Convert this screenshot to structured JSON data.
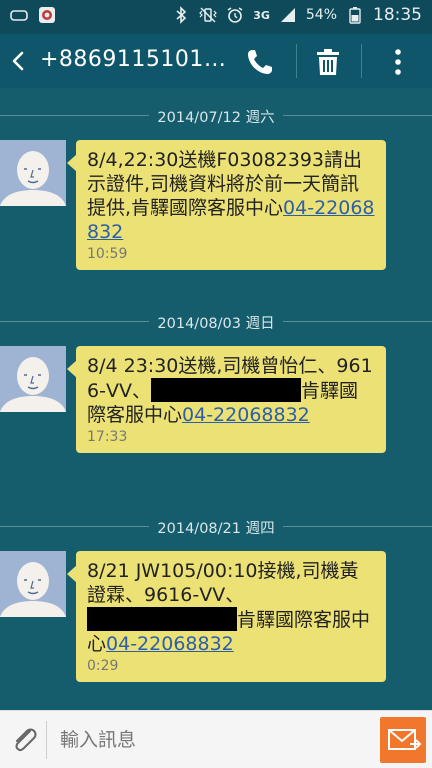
{
  "status_bar": {
    "time": "18:35",
    "battery": "54%",
    "network": "3G",
    "icons": [
      "notification-icon",
      "app-icon",
      "bluetooth-icon",
      "vibrate-icon",
      "alarm-icon",
      "signal-icon",
      "battery-icon"
    ]
  },
  "header": {
    "title": "+8869115101…",
    "icons": {
      "back": "back-arrow-icon",
      "call": "phone-icon",
      "delete": "trash-icon",
      "more": "more-vert-icon"
    }
  },
  "messages": [
    {
      "date": "2014/07/12 週六",
      "text_before": "8/4,22:30送機F03082393請出示證件,司機資料將於前一天簡訊提供,肯驛國際客服中心",
      "phone": "04-22068832",
      "time": "10:59"
    },
    {
      "date": "2014/08/03 週日",
      "text_before": "8/4 23:30送機,司機曾怡仁、9616-VV、",
      "text_after": "肯驛國際客服中心",
      "phone": "04-22068832",
      "time": "17:33"
    },
    {
      "date": "2014/08/21 週四",
      "text_before": "8/21 JW105/00:10接機,司機黃證霖、9616-VV、",
      "text_after": "肯驛國際客服中心",
      "phone": "04-22068832",
      "time": "0:29"
    }
  ],
  "input": {
    "placeholder": "輸入訊息",
    "icons": {
      "attach": "paperclip-icon",
      "send": "send-envelope-icon"
    }
  },
  "colors": {
    "background": "#155c6d",
    "appbar": "#10566a",
    "bubble": "#ece175",
    "link": "#2d5fa6",
    "send_button": "#f1772d"
  }
}
